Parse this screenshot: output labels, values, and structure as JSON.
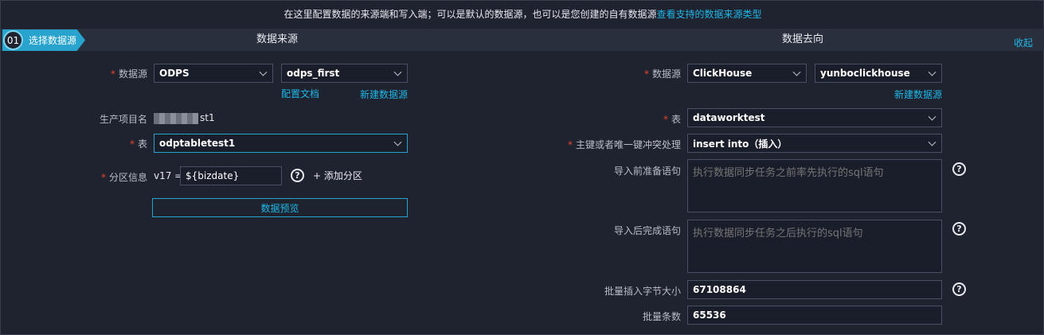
{
  "banner": {
    "text": "在这里配置数据的来源端和写入端；可以是默认的数据源，也可以是您创建的自有数据源",
    "link": "查看支持的数据来源类型"
  },
  "step": {
    "num": "01",
    "label": "选择数据源"
  },
  "collapse_label": "收起",
  "source": {
    "title": "数据来源",
    "datasource_label": "数据源",
    "datasource_type": "ODPS",
    "datasource_name": "odps_first",
    "config_doc_link": "配置文档",
    "new_datasource_link": "新建数据源",
    "project_label": "生产项目名",
    "project_value_suffix": "st1",
    "table_label": "表",
    "table_value": "odptabletest1",
    "partition_label": "分区信息",
    "partition_key": "v17 =",
    "partition_value": "${bizdate}",
    "add_partition": "+ 添加分区",
    "preview_button": "数据预览"
  },
  "target": {
    "title": "数据去向",
    "datasource_label": "数据源",
    "datasource_type": "ClickHouse",
    "datasource_name": "yunboclickhouse",
    "new_datasource_link": "新建数据源",
    "table_label": "表",
    "table_value": "dataworktest",
    "conflict_label": "主键或者唯一键冲突处理",
    "conflict_value": "insert into（插入）",
    "pre_sql_label": "导入前准备语句",
    "pre_sql_placeholder": "执行数据同步任务之前率先执行的sql语句",
    "post_sql_label": "导入后完成语句",
    "post_sql_placeholder": "执行数据同步任务之后执行的sql语句",
    "batch_bytes_label": "批量插入字节大小",
    "batch_bytes_value": "67108864",
    "batch_count_label": "批量条数",
    "batch_count_value": "65536"
  },
  "colors": {
    "accent": "#27a3cd",
    "link": "#1fb7e6",
    "required": "#e5432a",
    "background": "#1f2330"
  },
  "icons": {
    "help": "question-circle-icon",
    "dropdown": "chevron-down-icon"
  }
}
